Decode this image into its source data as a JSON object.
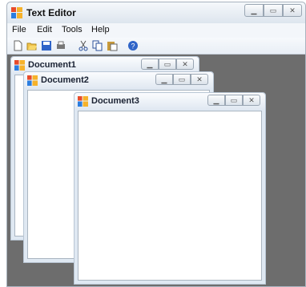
{
  "window": {
    "title": "Text Editor"
  },
  "menu": [
    "File",
    "Edit",
    "Tools",
    "Help"
  ],
  "toolbar": [
    "new-icon",
    "open-icon",
    "save-icon",
    "print-icon",
    "cut-icon",
    "copy-icon",
    "paste-icon",
    "help-icon"
  ],
  "documents": [
    {
      "title": "Document1"
    },
    {
      "title": "Document2"
    },
    {
      "title": "Document3"
    }
  ],
  "colors": {
    "mdi_background": "#6d6d6d",
    "titlebar": "#e4ebf3",
    "client": "#ffffff"
  }
}
